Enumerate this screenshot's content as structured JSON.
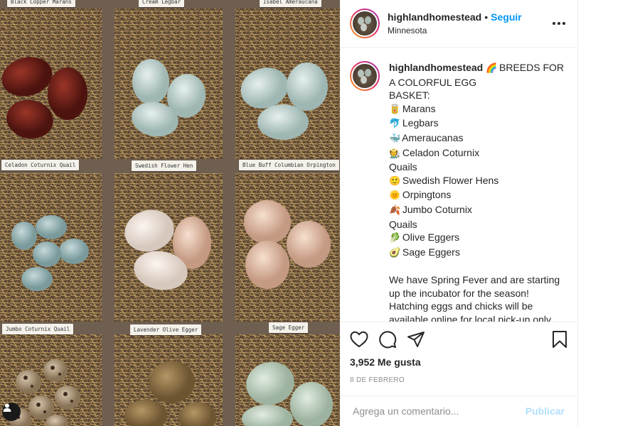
{
  "post": {
    "username": "highlandhomestead",
    "separator": "•",
    "follow_label": "Seguir",
    "location": "Minnesota",
    "more_icon": "more-options-icon"
  },
  "photo": {
    "tags": [
      "Black Copper Marans",
      "Cream Legbar",
      "Isabel Ameraucana",
      "Celadon Coturnix Quail",
      "Swedish Flower Hen",
      "Blue Buff Columbian Orpington",
      "Jumbo Coturnix Quail",
      "Lavender Olive Egger",
      "Sage Egger"
    ]
  },
  "caption": {
    "username": "highlandhomestead",
    "lines": [
      {
        "emoji": "🌈",
        "text": "BREEDS FOR"
      },
      {
        "emoji": "",
        "text": "A COLORFUL EGG"
      },
      {
        "emoji": "",
        "text": "BASKET:"
      },
      {
        "emoji": "🥫",
        "text": "Marans"
      },
      {
        "emoji": "🐬",
        "text": "Legbars"
      },
      {
        "emoji": "🐳",
        "text": "Ameraucanas"
      },
      {
        "emoji": "🧑‍🌾",
        "text": "Celadon Coturnix"
      },
      {
        "emoji": "",
        "text": "Quails"
      },
      {
        "emoji": "🙂",
        "text": "Swedish Flower Hens"
      },
      {
        "emoji": "🌞",
        "text": "Orpingtons"
      },
      {
        "emoji": "🍂",
        "text": "Jumbo Coturnix"
      },
      {
        "emoji": "",
        "text": "Quails"
      },
      {
        "emoji": "🥬",
        "text": "Olive Eggers"
      },
      {
        "emoji": "🥑",
        "text": "Sage Eggers"
      }
    ],
    "paragraph": "We have Spring Fever and are starting up the incubator for the season! Hatching eggs and chicks will be available online for local pick-up only beginning the end of February."
  },
  "actions": {
    "like_icon": "heart-icon",
    "comment_icon": "comment-icon",
    "share_icon": "share-icon",
    "save_icon": "bookmark-icon",
    "likes": "3,952 Me gusta",
    "date": "8 DE FEBRERO"
  },
  "comment": {
    "placeholder": "Agrega un comentario...",
    "publish_label": "Publicar"
  },
  "colors": {
    "follow": "#0095f6",
    "publish_disabled": "#b2dffc",
    "muted": "#8e8e8e"
  }
}
